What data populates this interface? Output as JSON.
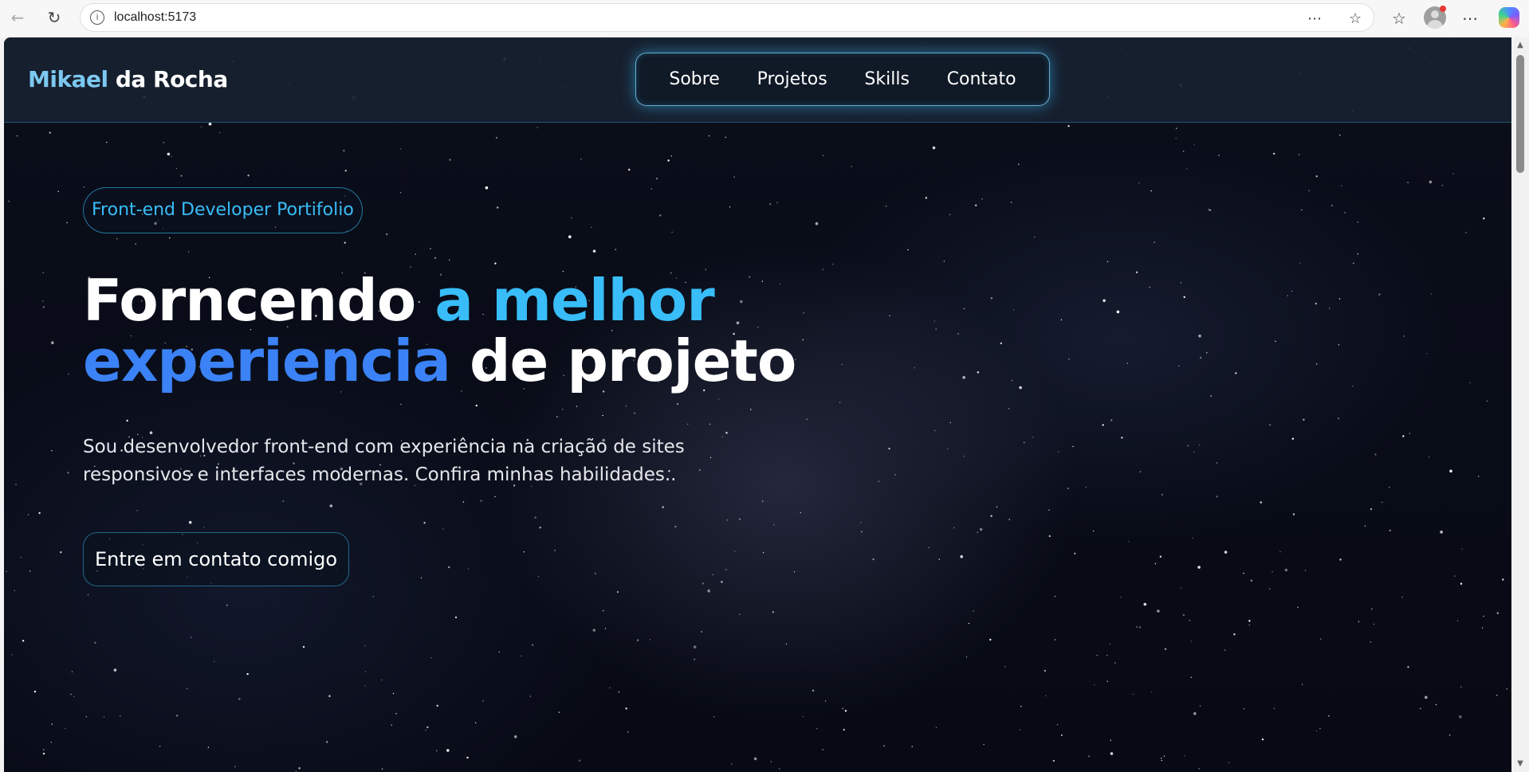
{
  "browser": {
    "url": "localhost:5173",
    "icons": {
      "back": "back-arrow-icon",
      "reload": "reload-icon",
      "info": "info-icon",
      "reader": "reader-mode-icon",
      "favorite": "star-icon",
      "favorites_bar": "favorites-icon",
      "profile": "profile-icon",
      "more": "more-icon",
      "copilot": "copilot-icon"
    }
  },
  "site": {
    "logo_first": "Mikael",
    "logo_rest": " da Rocha",
    "menu": [
      {
        "label": "Sobre"
      },
      {
        "label": "Projetos"
      },
      {
        "label": "Skills"
      },
      {
        "label": "Contato"
      }
    ]
  },
  "hero": {
    "badge": "Front-end Developer Portifolio",
    "title_part1": "Forncendo ",
    "title_part2": "a melhor",
    "title_part3": "experiencia",
    "title_part4": " de projeto",
    "description": "Sou desenvolvedor front-end com experiência na criação de sites responsivos e interfaces modernas. Confira minhas habilidades..",
    "cta_label": "Entre em contato comigo"
  },
  "colors": {
    "accent_cyan": "#38bdf8",
    "accent_blue": "#3b82f6",
    "logo_first": "#7cc8f0",
    "background": "#070a14"
  }
}
